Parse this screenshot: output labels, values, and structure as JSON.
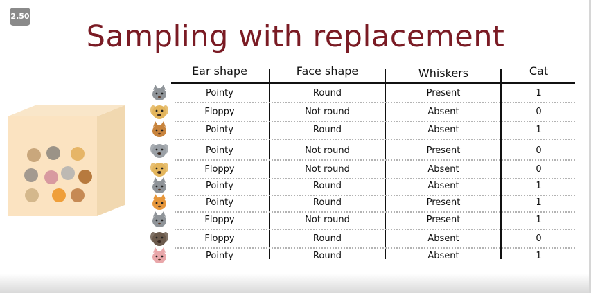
{
  "player": {
    "speed_label": "2.50"
  },
  "slide": {
    "title": "Sampling with replacement",
    "columns": [
      "Ear shape",
      "Face shape",
      "Whiskers",
      "Cat"
    ],
    "rows": [
      {
        "animal": "cat",
        "ear": "Pointy",
        "face": "Round",
        "whiskers": "Present",
        "cat": "1"
      },
      {
        "animal": "dog",
        "ear": "Floppy",
        "face": "Not round",
        "whiskers": "Absent",
        "cat": "0"
      },
      {
        "animal": "cat",
        "ear": "Pointy",
        "face": "Round",
        "whiskers": "Absent",
        "cat": "1"
      },
      {
        "animal": "dog",
        "ear": "Pointy",
        "face": "Not round",
        "whiskers": "Present",
        "cat": "0"
      },
      {
        "animal": "dog",
        "ear": "Floppy",
        "face": "Not round",
        "whiskers": "Absent",
        "cat": "0"
      },
      {
        "animal": "cat",
        "ear": "Pointy",
        "face": "Round",
        "whiskers": "Absent",
        "cat": "1"
      },
      {
        "animal": "cat",
        "ear": "Pointy",
        "face": "Round",
        "whiskers": "Present",
        "cat": "1"
      },
      {
        "animal": "cat",
        "ear": "Floppy",
        "face": "Not round",
        "whiskers": "Present",
        "cat": "1"
      },
      {
        "animal": "dog",
        "ear": "Floppy",
        "face": "Round",
        "whiskers": "Absent",
        "cat": "0"
      },
      {
        "animal": "cat",
        "ear": "Pointy",
        "face": "Round",
        "whiskers": "Absent",
        "cat": "1"
      }
    ]
  }
}
